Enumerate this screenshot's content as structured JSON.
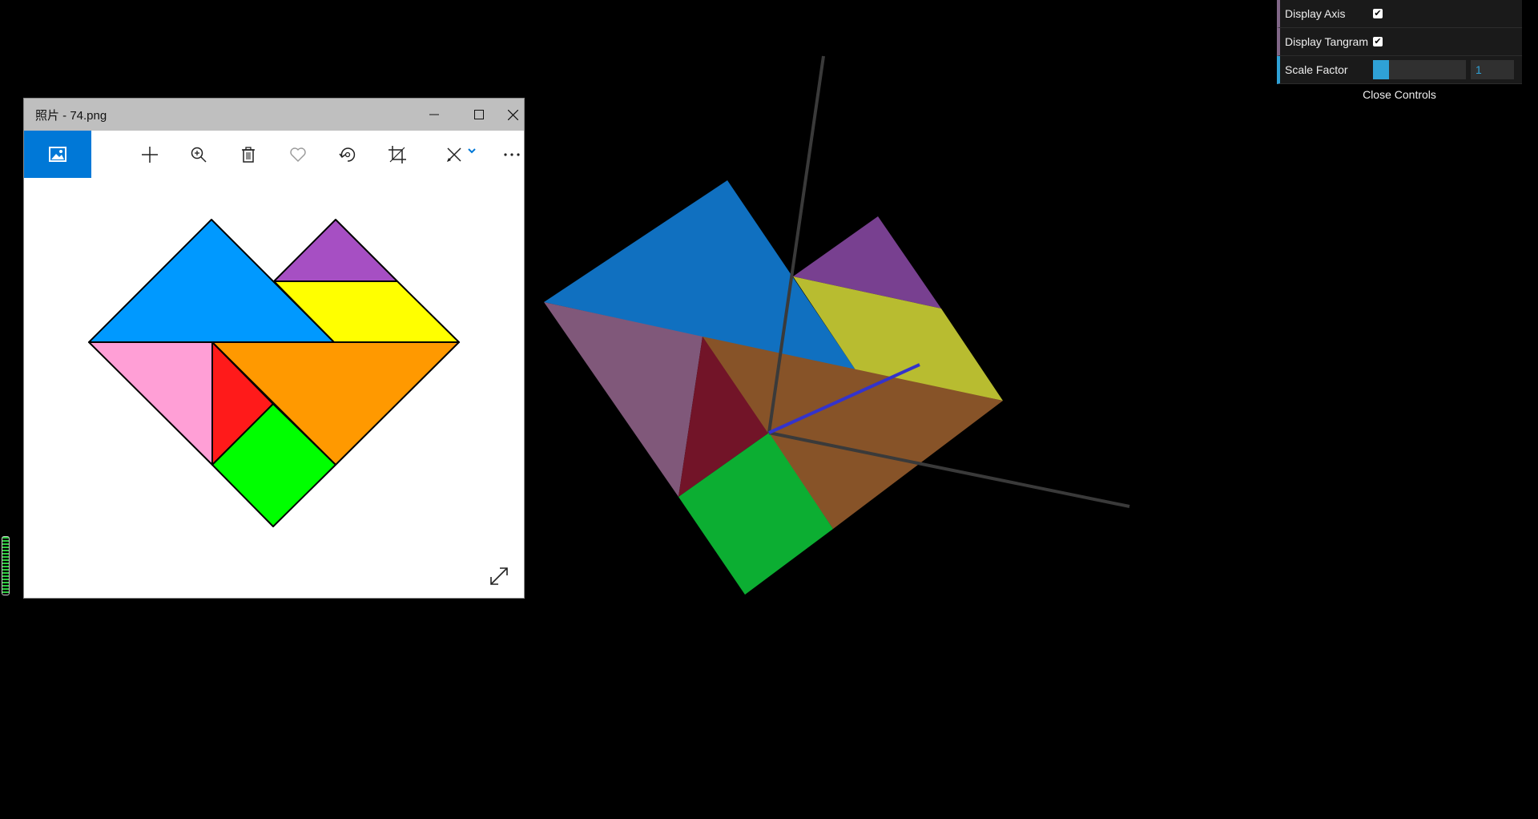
{
  "controls": {
    "display_axis": {
      "label": "Display Axis",
      "checked": true
    },
    "display_tangram": {
      "label": "Display Tangram",
      "checked": true
    },
    "scale_factor": {
      "label": "Scale Factor",
      "value": "1",
      "fraction": 0.0
    },
    "close_label": "Close Controls"
  },
  "photos": {
    "title": "照片 - 74.png",
    "toolbar_icons": [
      "image-icon",
      "add-icon",
      "zoom-icon",
      "delete-icon",
      "favorite-icon",
      "rotate-icon",
      "crop-icon",
      "edit-icon",
      "more-icon"
    ]
  },
  "colors": {
    "tangram_blue": "#0099ff",
    "tangram_purple": "#a64fc3",
    "tangram_yellow": "#ffff00",
    "tangram_pink": "#ff9fd6",
    "tangram_red": "#ff1a1a",
    "tangram_orange": "#ff9900",
    "tangram_green": "#00ff00",
    "scene_blue": "#1070c0",
    "scene_purple": "#784090",
    "scene_yellow": "#b8bc30",
    "scene_mauve": "#80587a",
    "scene_maroon": "#721428",
    "scene_brown": "#875328",
    "scene_green": "#0cae32",
    "accent": "#0078d7"
  }
}
